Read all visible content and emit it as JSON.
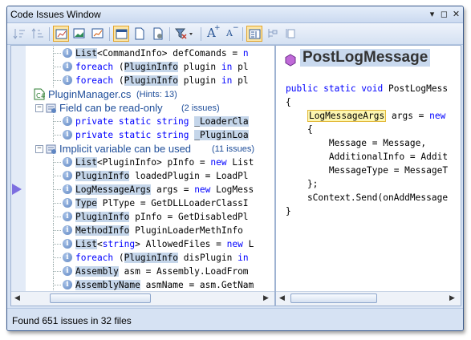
{
  "window": {
    "title": "Code Issues Window",
    "controls": {
      "pin": "▾",
      "restore": "◻",
      "close": "✕"
    }
  },
  "toolbar": {
    "icons": [
      "sort-icon",
      "sort-alt-icon",
      "chart-icon",
      "chart-area-icon",
      "chart-line-icon",
      "window-icon",
      "document-icon",
      "document-settings-icon",
      "filter-icon",
      "font-increase-icon",
      "font-decrease-icon",
      "split-view-icon",
      "tree-icon",
      "list-icon"
    ],
    "font_increase": "A",
    "font_decrease": "A"
  },
  "tree": {
    "rows": [
      {
        "type": "code",
        "parts": [
          [
            "hl",
            "List"
          ],
          [
            "",
            "<CommandInfo> defComands = "
          ],
          [
            "kw",
            "n"
          ]
        ]
      },
      {
        "type": "code",
        "parts": [
          [
            "kw",
            "foreach"
          ],
          [
            "",
            " ("
          ],
          [
            "hl",
            "PluginInfo"
          ],
          [
            "",
            " plugin "
          ],
          [
            "kw",
            "in"
          ],
          [
            "",
            " pl"
          ]
        ]
      },
      {
        "type": "code",
        "parts": [
          [
            "kw",
            "foreach"
          ],
          [
            "",
            " ("
          ],
          [
            "hl",
            "PluginInfo"
          ],
          [
            "",
            " plugin "
          ],
          [
            "kw",
            "in"
          ],
          [
            "",
            " pl"
          ]
        ]
      },
      {
        "type": "file",
        "name": "PluginManager.cs",
        "count": "(Hints: 13)"
      },
      {
        "type": "group",
        "name": "Field can be read-only",
        "count": "(2 issues)"
      },
      {
        "type": "code",
        "parts": [
          [
            "kw",
            "private static string"
          ],
          [
            "",
            " "
          ],
          [
            "hl",
            "_LoaderCla"
          ]
        ]
      },
      {
        "type": "code",
        "parts": [
          [
            "kw",
            "private static string"
          ],
          [
            "",
            " "
          ],
          [
            "hl",
            "_PluginLoa"
          ]
        ]
      },
      {
        "type": "group",
        "name": "Implicit variable can be used",
        "count": "(11 issues)"
      },
      {
        "type": "code",
        "parts": [
          [
            "hl",
            "List"
          ],
          [
            "",
            "<PluginInfo> pInfo = "
          ],
          [
            "kw",
            "new"
          ],
          [
            "",
            " List"
          ]
        ]
      },
      {
        "type": "code",
        "parts": [
          [
            "hl",
            "PluginInfo"
          ],
          [
            "",
            " loadedPlugin = LoadPl"
          ]
        ]
      },
      {
        "type": "code",
        "parts": [
          [
            "hl",
            "LogMessageArgs"
          ],
          [
            "",
            " args = "
          ],
          [
            "kw",
            "new"
          ],
          [
            "",
            " LogMess"
          ]
        ]
      },
      {
        "type": "code",
        "parts": [
          [
            "hl",
            "Type"
          ],
          [
            "",
            " PlType = GetDLLLoaderClassI"
          ]
        ]
      },
      {
        "type": "code",
        "parts": [
          [
            "hl",
            "PluginInfo"
          ],
          [
            "",
            " pInfo = GetDisabledPl"
          ]
        ]
      },
      {
        "type": "code",
        "parts": [
          [
            "hl",
            "MethodInfo"
          ],
          [
            "",
            " PluginLoaderMethInfo "
          ]
        ]
      },
      {
        "type": "code",
        "parts": [
          [
            "hl",
            "List"
          ],
          [
            "",
            "<"
          ],
          [
            "kw",
            "string"
          ],
          [
            "",
            "> AllowedFiles = "
          ],
          [
            "kw",
            "new"
          ],
          [
            "",
            " L"
          ]
        ]
      },
      {
        "type": "code",
        "parts": [
          [
            "kw",
            "foreach"
          ],
          [
            "",
            " ("
          ],
          [
            "hl",
            "PluginInfo"
          ],
          [
            "",
            " disPlugin "
          ],
          [
            "kw",
            "in"
          ]
        ]
      },
      {
        "type": "code",
        "parts": [
          [
            "hl",
            "Assembly"
          ],
          [
            "",
            " asm = Assembly.LoadFrom"
          ]
        ]
      },
      {
        "type": "code",
        "parts": [
          [
            "hl",
            "AssemblyName"
          ],
          [
            "",
            " asmName = asm.GetNam"
          ]
        ]
      }
    ]
  },
  "preview": {
    "title": "PostLogMessage",
    "lines": [
      [
        [
          "kw",
          "public static void"
        ],
        [
          "",
          " PostLogMess"
        ]
      ],
      [
        [
          "",
          "{"
        ]
      ],
      [
        [
          "",
          "    "
        ],
        [
          "yhl",
          "LogMessageArgs"
        ],
        [
          "",
          " args = "
        ],
        [
          "kw",
          "new"
        ]
      ],
      [
        [
          "",
          "    {"
        ]
      ],
      [
        [
          "",
          "        Message = Message,"
        ]
      ],
      [
        [
          "",
          "        AdditionalInfo = Addit"
        ]
      ],
      [
        [
          "",
          "        MessageType = MessageT"
        ]
      ],
      [
        [
          "",
          "    };"
        ]
      ],
      [
        [
          "",
          "    sContext.Send(onAddMessage"
        ]
      ],
      [
        [
          "",
          "}"
        ]
      ]
    ]
  },
  "status": {
    "text": "Found 651 issues in 32 files"
  },
  "colors": {
    "keyword": "#0000ff",
    "highlight": "#c5d6ea",
    "group_text": "#1f4e9a",
    "pointer": "#7d6fe0"
  }
}
